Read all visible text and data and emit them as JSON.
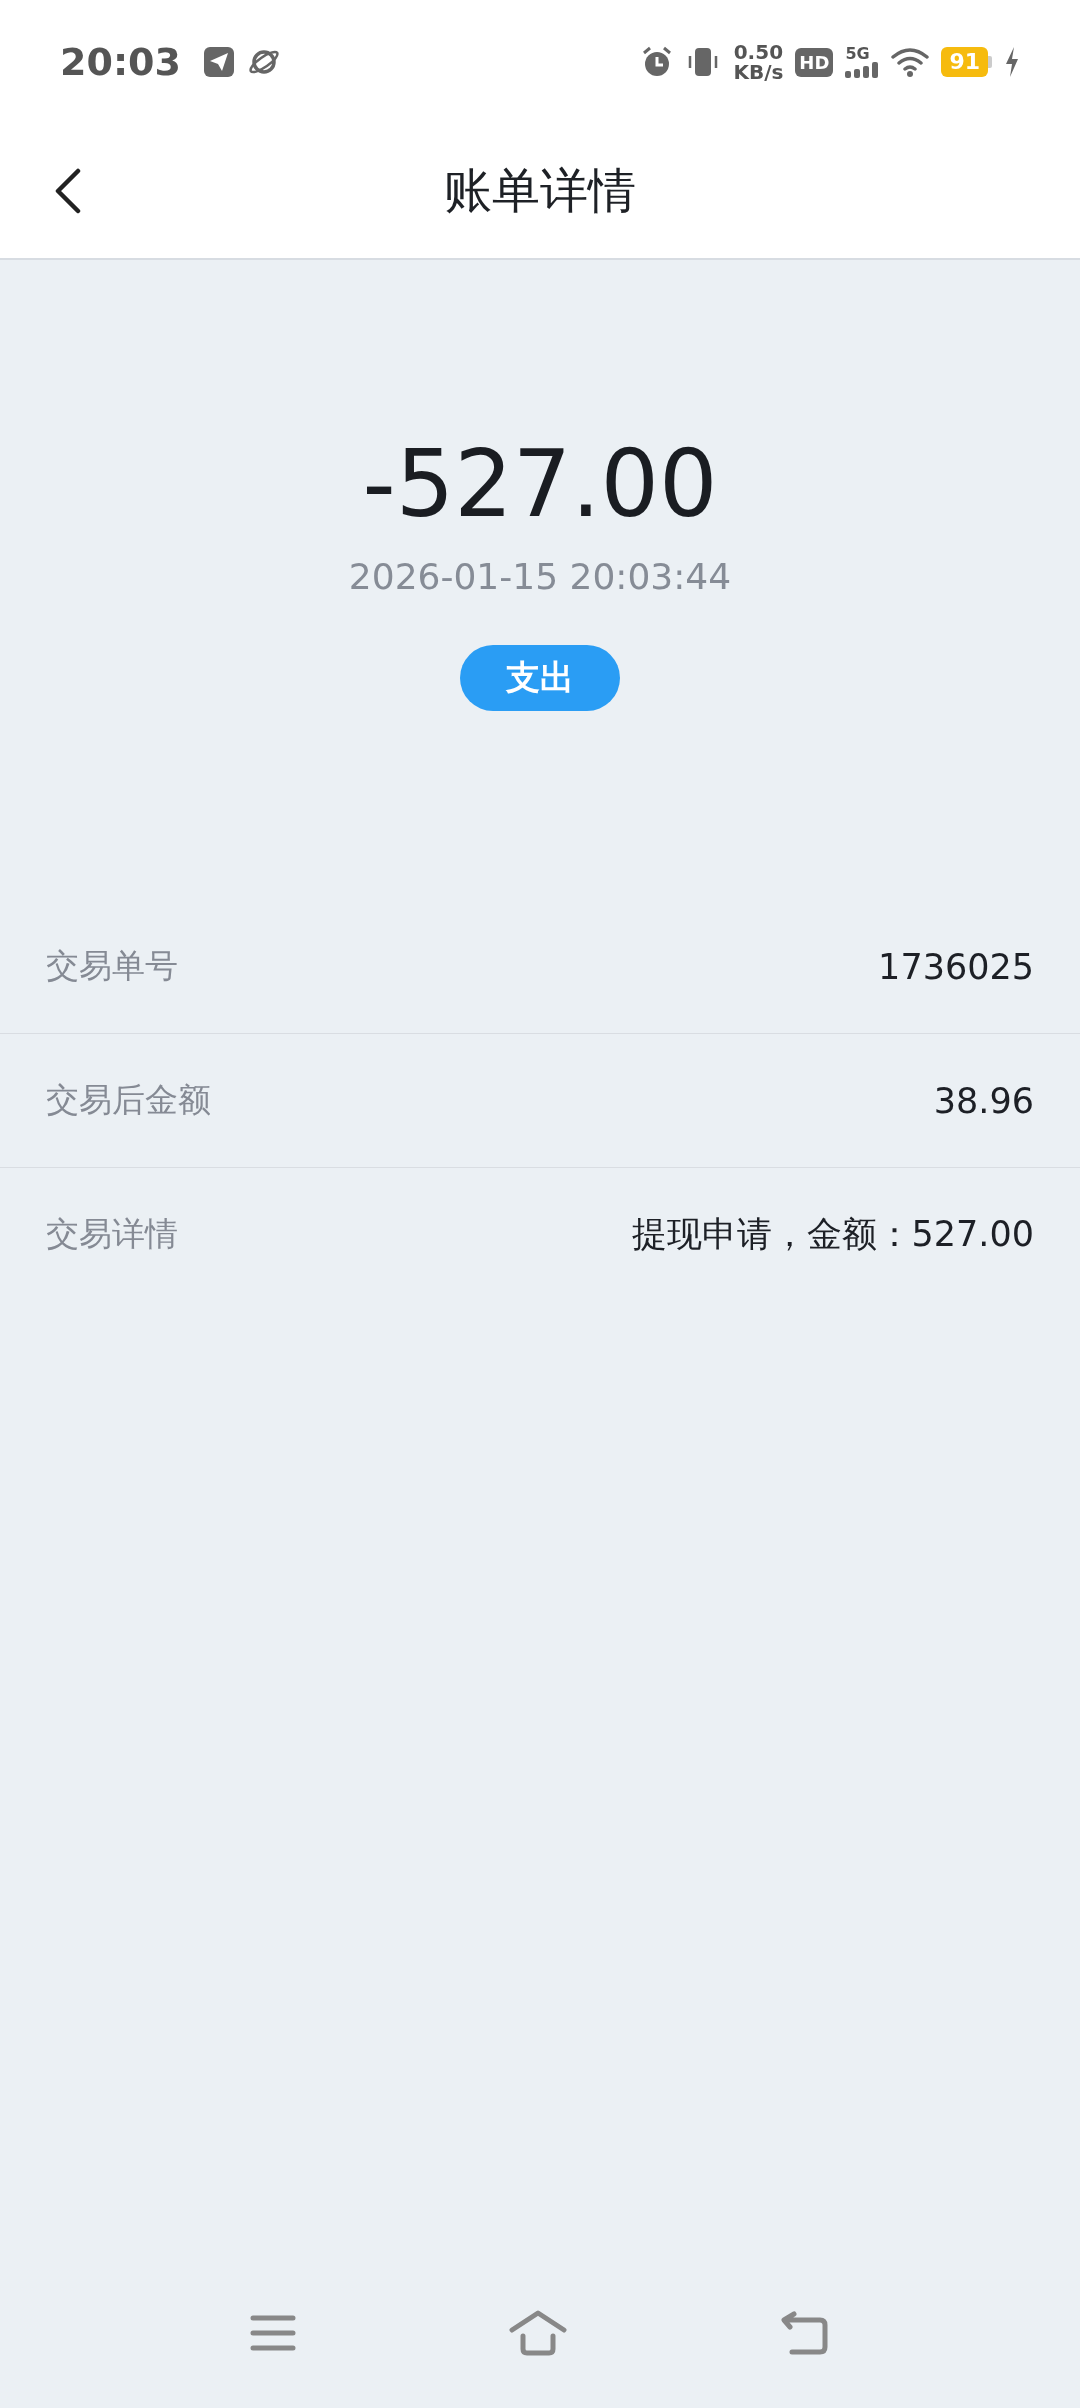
{
  "status_bar": {
    "time": "20:03",
    "speed_value": "0.50",
    "speed_unit": "KB/s",
    "hd": "HD",
    "network": "5G",
    "battery": "91"
  },
  "header": {
    "title": "账单详情"
  },
  "summary": {
    "amount": "-527.00",
    "datetime": "2026-01-15 20:03:44",
    "type_badge": "支出"
  },
  "details": [
    {
      "label": "交易单号",
      "value": "1736025"
    },
    {
      "label": "交易后金额",
      "value": "38.96"
    },
    {
      "label": "交易详情",
      "value": "提现申请，金额：527.00"
    }
  ]
}
